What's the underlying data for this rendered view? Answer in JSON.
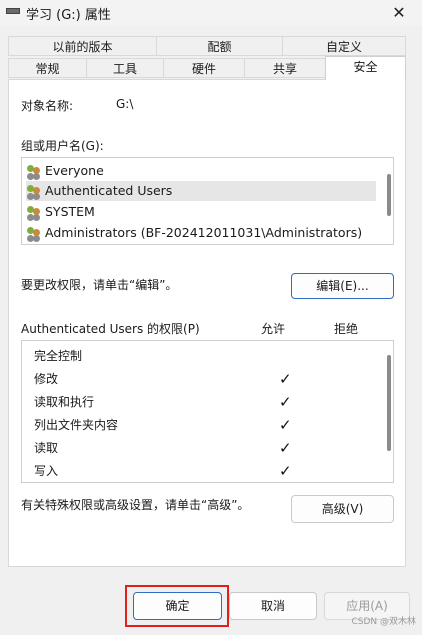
{
  "window": {
    "title": "学习 (G:) 属性",
    "close_glyph": "✕"
  },
  "tabs": {
    "row1": [
      "以前的版本",
      "配额",
      "自定义"
    ],
    "row2": [
      "常规",
      "工具",
      "硬件",
      "共享",
      "安全"
    ],
    "active": "安全"
  },
  "security": {
    "object_name_label": "对象名称:",
    "object_name_value": "G:\\",
    "groups_label": "组或用户名(G):",
    "groups": [
      {
        "name": "Everyone",
        "icon": "users-icon"
      },
      {
        "name": "Authenticated Users",
        "icon": "users-icon",
        "selected": true
      },
      {
        "name": "SYSTEM",
        "icon": "users-icon"
      },
      {
        "name": "Administrators (BF-202412011031\\Administrators)",
        "icon": "users-icon"
      }
    ],
    "change_hint": "要更改权限，请单击“编辑”。",
    "edit_button": "编辑(E)...",
    "perms_label": "Authenticated Users 的权限(P)",
    "allow_header": "允许",
    "deny_header": "拒绝",
    "permissions": [
      {
        "name": "完全控制",
        "allow": ""
      },
      {
        "name": "修改",
        "allow": "✓"
      },
      {
        "name": "读取和执行",
        "allow": "✓"
      },
      {
        "name": "列出文件夹内容",
        "allow": "✓"
      },
      {
        "name": "读取",
        "allow": "✓"
      },
      {
        "name": "写入",
        "allow": "✓"
      }
    ],
    "advanced_hint": "有关特殊权限或高级设置，请单击“高级”。",
    "advanced_button": "高级(V)"
  },
  "footer": {
    "ok": "确定",
    "cancel": "取消",
    "apply": "应用(A)"
  },
  "watermark": "CSDN @双木林"
}
